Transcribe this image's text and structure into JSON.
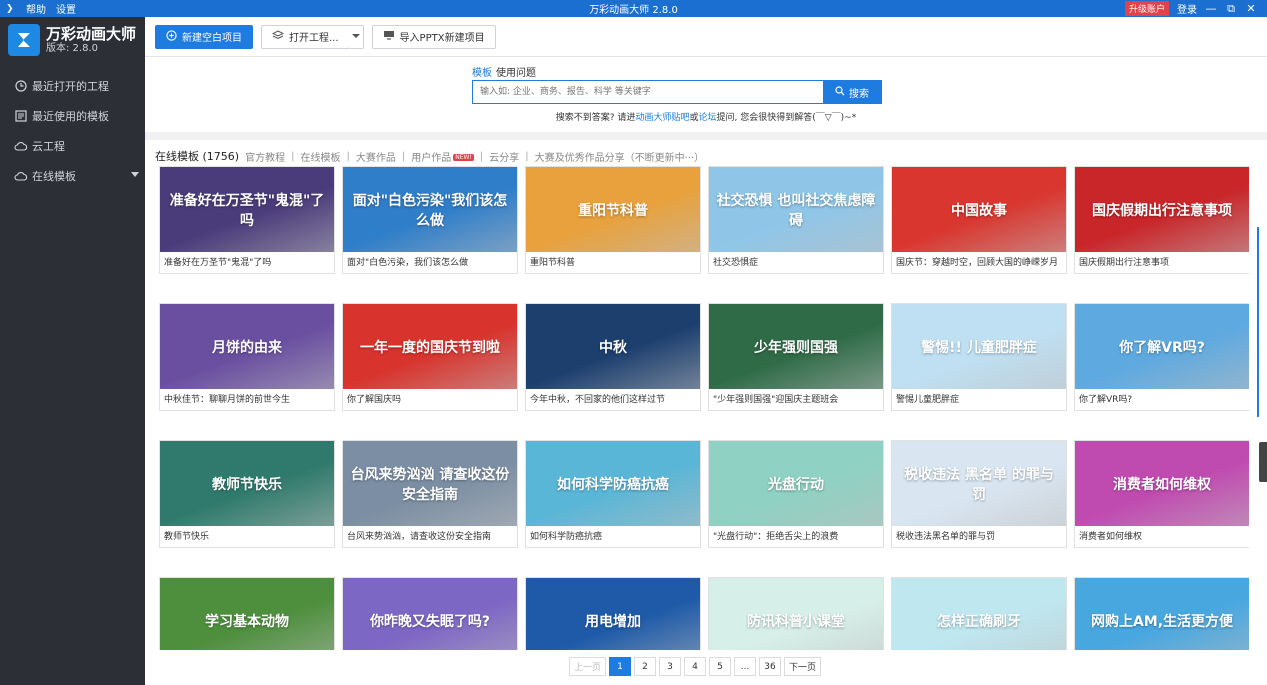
{
  "titlebar": {
    "menu_help": "帮助",
    "menu_settings": "设置",
    "title": "万彩动画大师 2.8.0",
    "upgrade": "升级账户",
    "login": "登录",
    "min": "—",
    "restore": "⧉",
    "close": "✕"
  },
  "sidebar": {
    "brand_title": "万彩动画大师",
    "brand_version": "版本: 2.8.0",
    "items": [
      {
        "label": "最近打开的工程",
        "icon": "clock-icon"
      },
      {
        "label": "最近使用的模板",
        "icon": "template-icon"
      },
      {
        "label": "云工程",
        "icon": "cloud-icon"
      },
      {
        "label": "在线模板",
        "icon": "cloud-icon"
      }
    ]
  },
  "toolbar": {
    "new_project": "新建空白项目",
    "open_project": "打开工程...",
    "import_pptx": "导入PPTX新建项目"
  },
  "search": {
    "tab_template": "模板",
    "tab_faq": "使用问题",
    "placeholder": "输入如: 企业、商务、报告、科学 等关键字",
    "button": "搜索",
    "hint_pre": "搜索不到答案? 请进",
    "hint_link1": "动画大师贴吧",
    "hint_or": "或",
    "hint_link2": "论坛",
    "hint_post": "提问, 您会很快得到解答(￣▽￣)~*"
  },
  "categories": {
    "count_label": "在线模板 (1756)",
    "items": [
      "官方教程",
      "在线模板",
      "大赛作品",
      "用户作品",
      "云分享",
      "大赛及优秀作品分享（不断更新中···）"
    ],
    "new_badge": "NEW!"
  },
  "templates": [
    {
      "title": "准备好在万圣节\"鬼混\"了吗",
      "thumb_text": "准备好在万圣节\"鬼混\"了吗",
      "color": "#4a3b7a"
    },
    {
      "title": "面对\"白色污染，我们该怎么做",
      "thumb_text": "面对\"白色污染\"我们该怎么做",
      "color": "#2f7ec9"
    },
    {
      "title": "重阳节科普",
      "thumb_text": "重阳节科普",
      "color": "#e8a13c"
    },
    {
      "title": "社交恐惧症",
      "thumb_text": "社交恐惧 也叫社交焦虑障碍",
      "color": "#8fc6e8"
    },
    {
      "title": "国庆节：穿越时空，回顾大国的峥嵘岁月",
      "thumb_text": "中国故事",
      "color": "#d9362f"
    },
    {
      "title": "国庆假期出行注意事项",
      "thumb_text": "国庆假期出行注意事项",
      "color": "#c9262a"
    },
    {
      "title": "中秋佳节：聊聊月饼的前世今生",
      "thumb_text": "月饼的由来",
      "color": "#6a4fa0"
    },
    {
      "title": "你了解国庆吗",
      "thumb_text": "一年一度的国庆节到啦",
      "color": "#d8332d"
    },
    {
      "title": "今年中秋，不回家的他们这样过节",
      "thumb_text": "中秋",
      "color": "#1c3f6e"
    },
    {
      "title": "\"少年强则国强\"迎国庆主题班会",
      "thumb_text": "少年强则国强",
      "color": "#2f6b47"
    },
    {
      "title": "警惕儿童肥胖症",
      "thumb_text": "警惕!! 儿童肥胖症",
      "color": "#bfe0f3"
    },
    {
      "title": "你了解VR吗?",
      "thumb_text": "你了解VR吗?",
      "color": "#5ea9e0"
    },
    {
      "title": "教师节快乐",
      "thumb_text": "教师节快乐",
      "color": "#2f7a6c"
    },
    {
      "title": "台风来势汹汹，请查收这份安全指南",
      "thumb_text": "台风来势汹汹 请查收这份安全指南",
      "color": "#7b8ea3"
    },
    {
      "title": "如何科学防癌抗癌",
      "thumb_text": "如何科学防癌抗癌",
      "color": "#5ab6d6"
    },
    {
      "title": "\"光盘行动\"：拒绝舌尖上的浪费",
      "thumb_text": "光盘行动",
      "color": "#8fd1c2"
    },
    {
      "title": "税收违法黑名单的罪与罚",
      "thumb_text": "税收违法 黑名单 的罪与罚",
      "color": "#d9e6f2"
    },
    {
      "title": "消费者如何维权",
      "thumb_text": "消费者如何维权",
      "color": "#c04bb0"
    },
    {
      "title": "",
      "thumb_text": "学习基本动物",
      "color": "#4e8f3e"
    },
    {
      "title": "",
      "thumb_text": "你昨晚又失眠了吗?",
      "color": "#7d67c4"
    },
    {
      "title": "",
      "thumb_text": "用电增加",
      "color": "#1e5aa8"
    },
    {
      "title": "",
      "thumb_text": "防讯科普小课堂",
      "color": "#d7efe9"
    },
    {
      "title": "",
      "thumb_text": "怎样正确刷牙",
      "color": "#bfe7f0"
    },
    {
      "title": "",
      "thumb_text": "网购上AM,生活更方便",
      "color": "#49a7e0"
    }
  ],
  "pager": {
    "prev": "上一页",
    "pages": [
      "1",
      "2",
      "3",
      "4",
      "5",
      "...",
      "36"
    ],
    "next": "下一页",
    "current": "1"
  }
}
